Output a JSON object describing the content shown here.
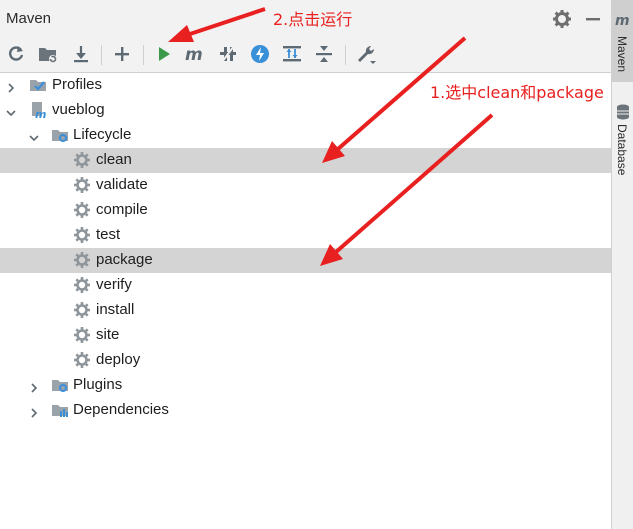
{
  "panel": {
    "title": "Maven"
  },
  "toolbar": {
    "buttons": [
      "reload-icon",
      "generate-sources-icon",
      "download-icon",
      "add-icon",
      "run-icon",
      "execute-goal-icon",
      "toggle-offline-icon",
      "skip-tests-icon",
      "show-dependencies-icon",
      "collapse-all-icon",
      "settings-icon"
    ],
    "accent_run": "#3b9a4a",
    "accent_skip": "#3a8fd9"
  },
  "tree": {
    "profiles": "Profiles",
    "project": "vueblog",
    "lifecycle": "Lifecycle",
    "goals": [
      "clean",
      "validate",
      "compile",
      "test",
      "package",
      "verify",
      "install",
      "site",
      "deploy"
    ],
    "plugins": "Plugins",
    "dependencies": "Dependencies"
  },
  "rightbar": {
    "tabs": [
      "Maven",
      "Database"
    ]
  },
  "annotations": {
    "step2": "2.点击运行",
    "step1": "1.选中clean和package",
    "color": "#e8201f"
  }
}
